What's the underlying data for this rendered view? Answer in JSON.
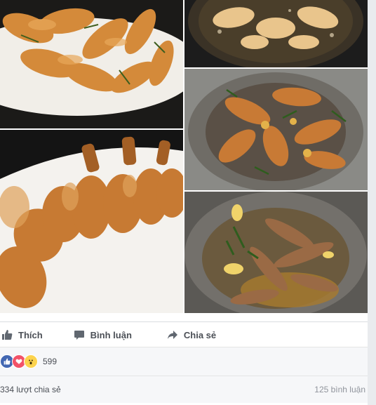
{
  "actions": {
    "like_label": "Thích",
    "comment_label": "Bình luận",
    "share_label": "Chia sẻ"
  },
  "reactions": {
    "count": "599",
    "icons": [
      "like-reaction-icon",
      "love-reaction-icon",
      "wow-reaction-icon"
    ]
  },
  "stats": {
    "shares_text": "334 lượt chia sẻ",
    "comments_text": "125 bình luận"
  },
  "colors": {
    "like_blue": "#4267b2",
    "love_red": "#f25268",
    "wow_yellow": "#fcd34d",
    "text_gray": "#4b4f56"
  }
}
